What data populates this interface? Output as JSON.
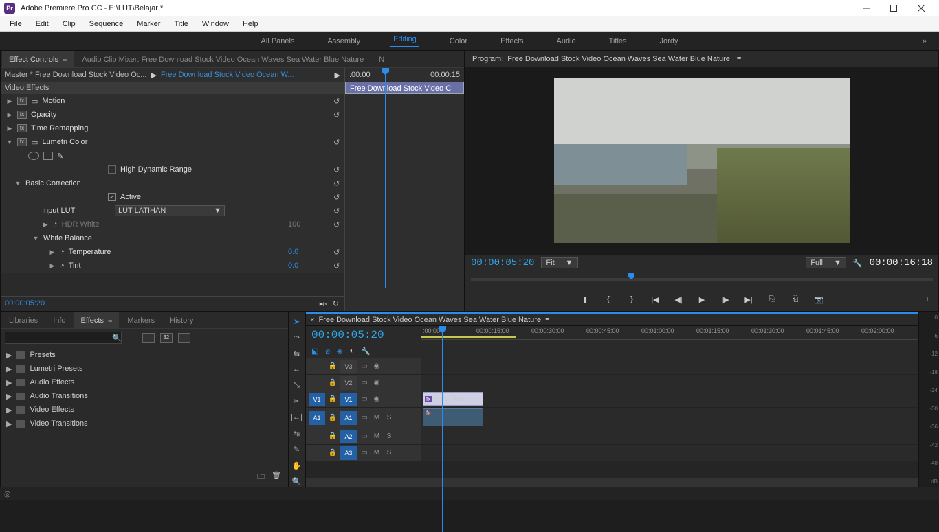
{
  "titlebar": {
    "app": "Pr",
    "title": "Adobe Premiere Pro CC - E:\\LUT\\Belajar *"
  },
  "filemenu": [
    "File",
    "Edit",
    "Clip",
    "Sequence",
    "Marker",
    "Title",
    "Window",
    "Help"
  ],
  "workspaces": {
    "items": [
      "All Panels",
      "Assembly",
      "Editing",
      "Color",
      "Effects",
      "Audio",
      "Titles",
      "Jordy"
    ],
    "active": "Editing",
    "more": "»"
  },
  "effectControls": {
    "tab1": "Effect Controls",
    "tabmenu": "≡",
    "tab2": "Audio Clip Mixer: Free Download Stock Video Ocean Waves Sea Water Blue Nature",
    "tab3": "N",
    "master": "Master * Free Download Stock Video Oc...",
    "clip": "Free Download Stock Video Ocean W...",
    "timeStart": ":00:00",
    "timeEnd": "00:00:15",
    "clipbar": "Free Download Stock Video C",
    "sectionVideo": "Video Effects",
    "motion": "Motion",
    "opacity": "Opacity",
    "timeremap": "Time Remapping",
    "lumetri": "Lumetri Color",
    "highdr": "High Dynamic Range",
    "basiccorr": "Basic Correction",
    "active": "Active",
    "inputlut_label": "Input LUT",
    "inputlut_value": "LUT LATIHAN",
    "hdrwhite_label": "HDR White",
    "hdrwhite_value": "100",
    "whitebal": "White Balance",
    "temperature": "Temperature",
    "tint": "Tint",
    "zero": "0.0",
    "timecode": "00:00:05:20",
    "reset": "↺"
  },
  "program": {
    "prefix": "Program:",
    "sequence": "Free Download Stock Video Ocean Waves Sea Water Blue Nature",
    "menu": "≡",
    "tcLeft": "00:00:05:20",
    "fit": "Fit",
    "full": "Full",
    "tcRight": "00:00:16:18",
    "wrench": "🔧",
    "plus": "+"
  },
  "effectsPanel": {
    "tabs": [
      "Libraries",
      "Info",
      "Effects",
      "Markers",
      "History"
    ],
    "active": "Effects",
    "menu": "≡",
    "search_placeholder": "",
    "catbtns": [
      "fx",
      "32",
      "YUV"
    ],
    "items": [
      "Presets",
      "Lumetri Presets",
      "Audio Effects",
      "Audio Transitions",
      "Video Effects",
      "Video Transitions"
    ]
  },
  "timeline": {
    "tools": [
      "select",
      "track-fwd",
      "ripple",
      "roll",
      "rate",
      "razor",
      "slip",
      "slide",
      "pen",
      "hand",
      "zoom"
    ],
    "seq_close": "×",
    "seq_name": "Free Download Stock Video Ocean Waves Sea Water Blue Nature",
    "seq_menu": "≡",
    "tc": "00:00:05:20",
    "opts": [
      "snap",
      "link",
      "marker",
      "settings",
      "wrench"
    ],
    "ticks": [
      ":00:00",
      "00:00:15:00",
      "00:00:30:00",
      "00:00:45:00",
      "00:01:00:00",
      "00:01:15:00",
      "00:01:30:00",
      "00:01:45:00",
      "00:02:00:00"
    ],
    "tracks": {
      "v3": {
        "src": "",
        "tgt": "V3"
      },
      "v2": {
        "src": "",
        "tgt": "V2"
      },
      "v1": {
        "src": "V1",
        "tgt": "V1",
        "clip": "Free Down"
      },
      "a1": {
        "src": "A1",
        "tgt": "A1"
      },
      "a2": {
        "src": "",
        "tgt": "A2"
      },
      "a3": {
        "src": "",
        "tgt": "A3"
      },
      "lock": "🔒",
      "sync": "▭",
      "eye": "👁",
      "m": "M",
      "s": "S",
      "fx": "fx"
    }
  },
  "audioMeter": {
    "labels": [
      "0",
      "-6",
      "-12",
      "-18",
      "-24",
      "-30",
      "-36",
      "-42",
      "-48",
      "dB"
    ]
  },
  "statusbar": {
    "ai": "◎"
  }
}
